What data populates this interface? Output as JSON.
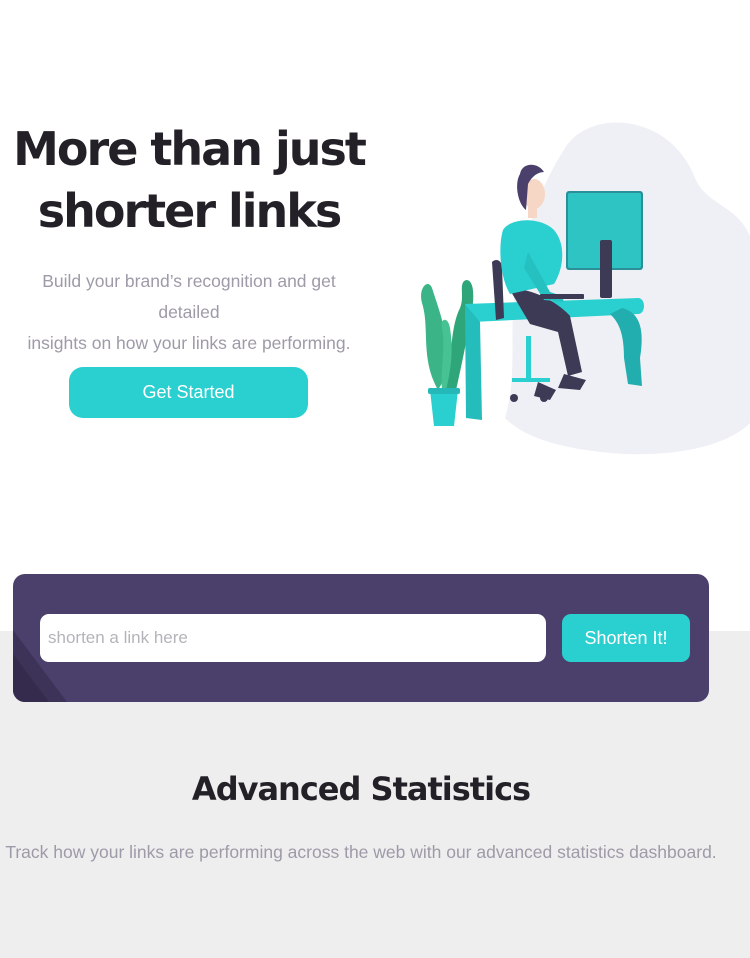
{
  "hero": {
    "title_line1": "More than just",
    "title_line2": "shorter links",
    "subtitle_line1": "Build your brand’s recognition and get detailed",
    "subtitle_line2": "insights on how your links are performing.",
    "cta_label": "Get Started",
    "illustration_icon": "person-working-at-desk-illustration"
  },
  "shorten": {
    "placeholder": "shorten a link here",
    "value": "",
    "button_label": "Shorten It!"
  },
  "statistics": {
    "title": "Advanced Statistics",
    "subtitle": "Track how your links are performing across the web with our advanced statistics dashboard."
  },
  "colors": {
    "cyan": "#2acfcf",
    "dark_violet": "#4b3f6b",
    "very_dark": "#232127",
    "gray_text": "#9e9aa7",
    "light_gray_bg": "#eeeeef"
  }
}
